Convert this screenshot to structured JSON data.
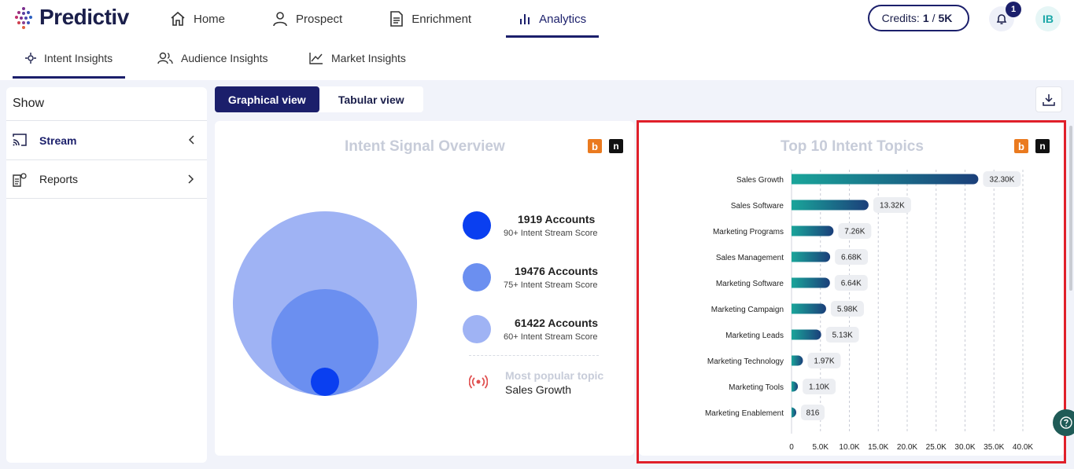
{
  "brand": {
    "name": "Predictiv"
  },
  "nav": {
    "items": [
      {
        "label": "Home",
        "icon": "home-icon"
      },
      {
        "label": "Prospect",
        "icon": "user-icon"
      },
      {
        "label": "Enrichment",
        "icon": "document-icon"
      },
      {
        "label": "Analytics",
        "icon": "bar-chart-icon",
        "active": true
      }
    ]
  },
  "header": {
    "credits_label": "Credits:",
    "credits_used": "1",
    "credits_sep": "/",
    "credits_total": "5K",
    "notification_count": "1",
    "avatar_initials": "IB"
  },
  "subtabs": [
    {
      "label": "Intent Insights",
      "active": true
    },
    {
      "label": "Audience Insights"
    },
    {
      "label": "Market Insights"
    }
  ],
  "sidebar": {
    "title": "Show",
    "items": [
      {
        "label": "Stream",
        "expanded": true
      },
      {
        "label": "Reports",
        "expanded": false
      }
    ]
  },
  "view_toggle": {
    "graphical": "Graphical view",
    "tabular": "Tabular view",
    "active": "graphical"
  },
  "overview": {
    "title": "Intent Signal Overview",
    "legend": [
      {
        "count": "1919 Accounts",
        "sub": "90+ Intent Stream Score",
        "color": "#0a3ff0"
      },
      {
        "count": "19476 Accounts",
        "sub": "75+ Intent Stream Score",
        "color": "#6b8ff0"
      },
      {
        "count": "61422 Accounts",
        "sub": "60+ Intent Stream Score",
        "color": "#9fb3f4"
      }
    ],
    "popular_label": "Most popular topic",
    "popular_value": "Sales Growth"
  },
  "chart_data": {
    "type": "bar",
    "orientation": "horizontal",
    "title": "Top 10 Intent Topics",
    "categories": [
      "Sales Growth",
      "Sales Software",
      "Marketing Programs",
      "Sales Management",
      "Marketing Software",
      "Marketing Campaign",
      "Marketing Leads",
      "Marketing Technology",
      "Marketing Tools",
      "Marketing Enablement"
    ],
    "values": [
      32300,
      13320,
      7260,
      6680,
      6640,
      5980,
      5130,
      1970,
      1100,
      816
    ],
    "data_labels": [
      "32.30K",
      "13.32K",
      "7.26K",
      "6.68K",
      "6.64K",
      "5.98K",
      "5.13K",
      "1.97K",
      "1.10K",
      "816"
    ],
    "xlim": [
      0,
      40000
    ],
    "xticks": [
      0,
      5000,
      10000,
      15000,
      20000,
      25000,
      30000,
      35000,
      40000
    ],
    "xtick_labels": [
      "0",
      "5.0K",
      "10.0K",
      "15.0K",
      "20.0K",
      "25.0K",
      "30.0K",
      "35.0K",
      "40.0K"
    ],
    "grid": true,
    "colors": {
      "start": "#1aa59a",
      "end": "#1b3f7a"
    }
  }
}
